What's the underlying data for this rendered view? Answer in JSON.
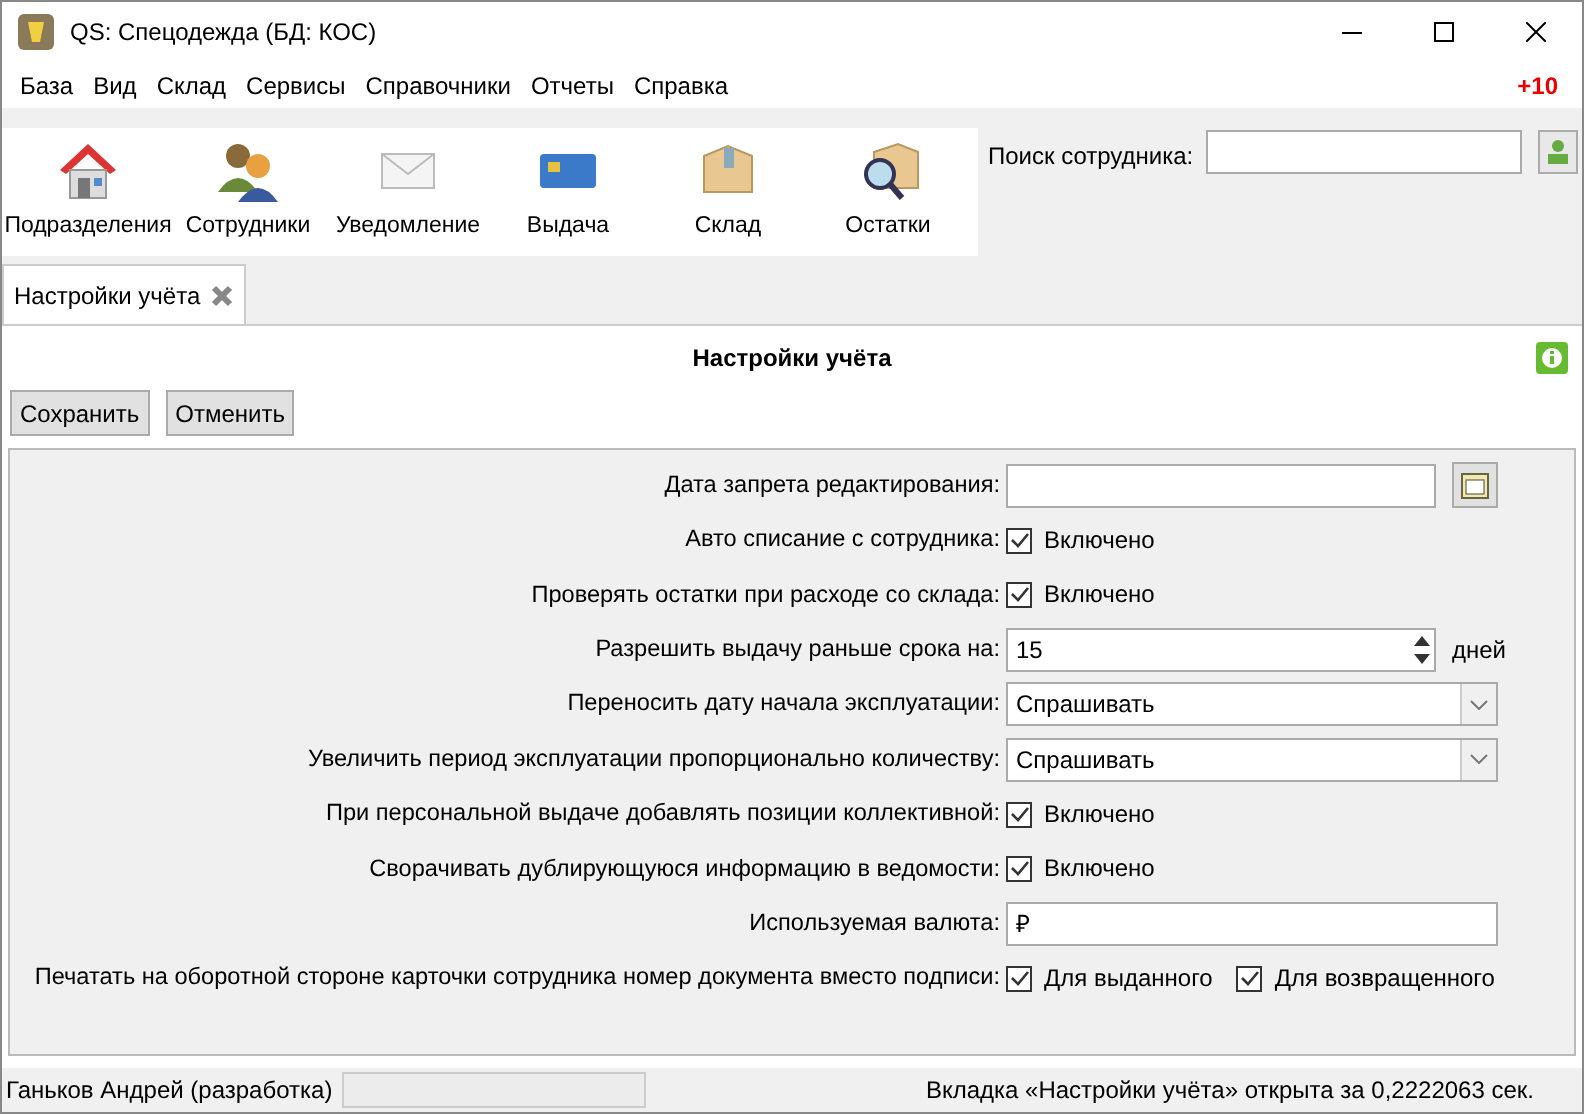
{
  "window": {
    "title": "QS: Спецодежда (БД: КОС)"
  },
  "menu": [
    "База",
    "Вид",
    "Склад",
    "Сервисы",
    "Справочники",
    "Отчеты",
    "Справка"
  ],
  "menu_badge": "+10",
  "toolbar": [
    {
      "label": "Подразделения",
      "kind": "house"
    },
    {
      "label": "Сотрудники",
      "kind": "people"
    },
    {
      "label": "Уведомление",
      "kind": "envelope"
    },
    {
      "label": "Выдача",
      "kind": "card"
    },
    {
      "label": "Склад",
      "kind": "box"
    },
    {
      "label": "Остатки",
      "kind": "search-box"
    }
  ],
  "search": {
    "label": "Поиск сотрудника:"
  },
  "tabs": [
    {
      "label": "Настройки учёта",
      "selected": true
    }
  ],
  "panel": {
    "title": "Настройки учёта",
    "buttons": [
      "Сохранить",
      "Отменить"
    ]
  },
  "settings": [
    {
      "kind": "date",
      "label": "Дата запрета редактирования:"
    },
    {
      "kind": "checkbox",
      "label": "Авто списание с сотрудника:",
      "options": [
        {
          "label": "Включено",
          "checked": true
        }
      ]
    },
    {
      "kind": "checkbox",
      "label": "Проверять остатки при расходе со склада:",
      "options": [
        {
          "label": "Включено",
          "checked": true
        }
      ]
    },
    {
      "kind": "spin",
      "label": "Разрешить выдачу раньше срока на:",
      "value": "15",
      "unit": "дней"
    },
    {
      "kind": "select",
      "label": "Переносить дату начала эксплуатации:",
      "value": "Спрашивать"
    },
    {
      "kind": "select",
      "label": "Увеличить период эксплуатации пропорционально количеству:",
      "value": "Спрашивать"
    },
    {
      "kind": "checkbox",
      "label": "При персональной выдаче добавлять позиции коллективной:",
      "options": [
        {
          "label": "Включено",
          "checked": true
        }
      ]
    },
    {
      "kind": "checkbox",
      "label": "Сворачивать дублирующуюся информацию в ведомости:",
      "options": [
        {
          "label": "Включено",
          "checked": true
        }
      ]
    },
    {
      "kind": "text",
      "label": "Используемая валюта:",
      "value": "₽"
    },
    {
      "kind": "checkbox",
      "label": "Печатать на оборотной стороне карточки сотрудника номер документа вместо подписи:",
      "options": [
        {
          "label": "Для выданного",
          "checked": true
        },
        {
          "label": "Для возвращенного",
          "checked": true
        }
      ]
    }
  ],
  "status_bar": {
    "user": "Ганьков Андрей (разработка)",
    "message": "Вкладка «Настройки учёта» открыта за 0,2222063 сек."
  }
}
